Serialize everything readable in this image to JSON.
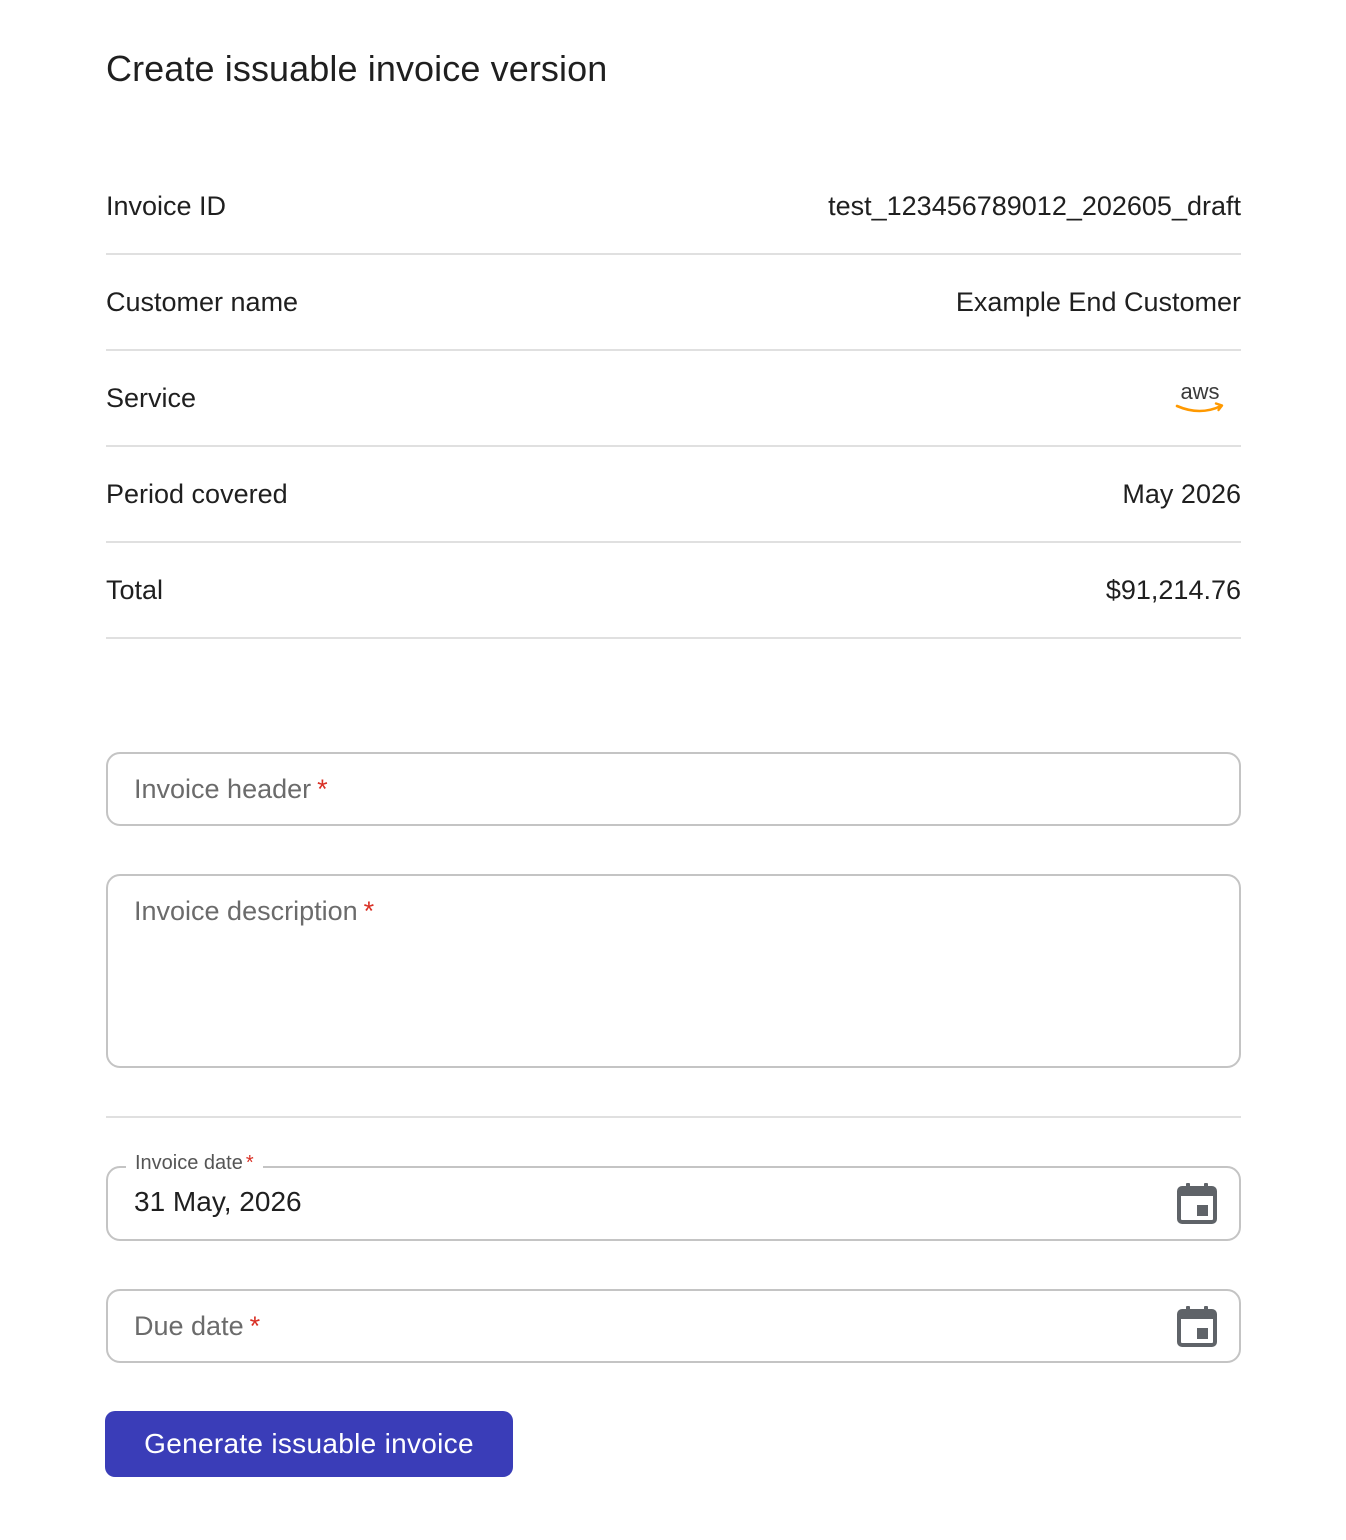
{
  "page": {
    "title": "Create issuable invoice version"
  },
  "summary": {
    "rows": [
      {
        "label": "Invoice ID",
        "value": "test_123456789012_202605_draft"
      },
      {
        "label": "Customer name",
        "value": "Example End Customer"
      },
      {
        "label": "Service",
        "value": "aws",
        "icon": "aws-logo"
      },
      {
        "label": "Period covered",
        "value": "May 2026"
      },
      {
        "label": "Total",
        "value": "$91,214.76"
      }
    ]
  },
  "form": {
    "invoice_header": {
      "placeholder": "Invoice header",
      "required_mark": "*",
      "value": ""
    },
    "invoice_description": {
      "placeholder": "Invoice description",
      "required_mark": "*",
      "value": ""
    },
    "invoice_date": {
      "label": "Invoice date",
      "required_mark": "*",
      "value": "31 May, 2026",
      "icon": "calendar-icon"
    },
    "due_date": {
      "placeholder": "Due date",
      "required_mark": "*",
      "value": "",
      "icon": "calendar-icon"
    }
  },
  "actions": {
    "generate_label": "Generate issuable invoice"
  },
  "colors": {
    "primary": "#3a3db8",
    "required": "#d93025",
    "aws_orange": "#ff9900",
    "border": "#c4c4c4",
    "divider": "#e0e0e0"
  }
}
